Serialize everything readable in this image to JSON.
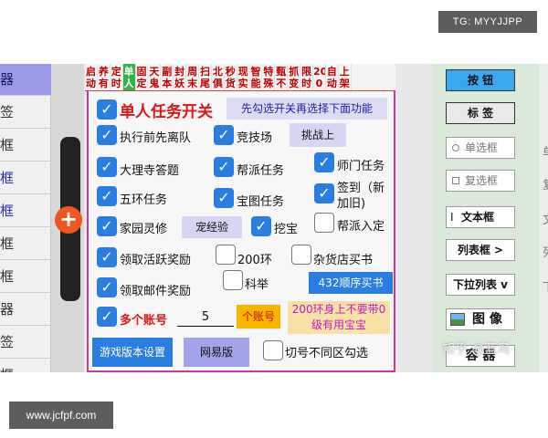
{
  "watermark_top": "TG: MYYJJPP",
  "watermark_bottom": "www.jcfpf.com",
  "watermark_zhihu": "知乎 @蓝鸟",
  "left_list": [
    {
      "text": "器",
      "state": "selected"
    },
    {
      "text": "签",
      "state": "normal"
    },
    {
      "text": "框",
      "state": "normal"
    },
    {
      "text": "框",
      "state": "blue"
    },
    {
      "text": "框",
      "state": "blue"
    },
    {
      "text": "框",
      "state": "normal"
    },
    {
      "text": "框",
      "state": "normal"
    },
    {
      "text": "器",
      "state": "normal"
    },
    {
      "text": "签",
      "state": "normal"
    },
    {
      "text": "框",
      "state": "normal"
    }
  ],
  "tabs": [
    {
      "top": "启",
      "bottom": "动"
    },
    {
      "top": "养",
      "bottom": "有"
    },
    {
      "top": "定",
      "bottom": "时"
    },
    {
      "top": "单",
      "bottom": "人",
      "active": true
    },
    {
      "top": "固",
      "bottom": "定"
    },
    {
      "top": "天",
      "bottom": "鬼"
    },
    {
      "top": "副",
      "bottom": "本"
    },
    {
      "top": "封",
      "bottom": "妖"
    },
    {
      "top": "周",
      "bottom": "末"
    },
    {
      "top": "扫",
      "bottom": "尾"
    },
    {
      "top": "北",
      "bottom": "俱"
    },
    {
      "top": "秒",
      "bottom": "货"
    },
    {
      "top": "现",
      "bottom": "实"
    },
    {
      "top": "智",
      "bottom": "能"
    },
    {
      "top": "特",
      "bottom": "殊"
    },
    {
      "top": "甄",
      "bottom": "不"
    },
    {
      "top": "抓",
      "bottom": "变"
    },
    {
      "top": "限",
      "bottom": "时"
    },
    {
      "top": "20",
      "bottom": "0"
    },
    {
      "top": "自",
      "bottom": "动"
    },
    {
      "top": "上",
      "bottom": "架"
    }
  ],
  "main": {
    "title": "单人任务开关",
    "hint_button": "先勾选开关再选择下面功能",
    "quit_team": "执行前先离队",
    "arena": "竞技场",
    "challenge_button": "挑战上",
    "dali_quiz": "大理寺答题",
    "faction_task": "帮派任务",
    "master_task": "师门任务",
    "five_ring": "五环任务",
    "treasure_map": "宝图任务",
    "signin": "签到（新加旧)",
    "home_spirit": "家园灵修",
    "pet_exp_button": "宠经验",
    "dig_treasure": "挖宝",
    "faction_join": "帮派入定",
    "activity_reward": "领取活跃奖励",
    "ring200": "200环",
    "grocery_buy": "杂货店买书",
    "exam": "科举",
    "mail_reward": "领取邮件奖励",
    "buy432_button": "432顺序买书",
    "multi_account": "多个账号",
    "account_count": "5",
    "account_button": "个账号",
    "ring_note_button": "200环身上不要带0级有用宝宝",
    "version_button": "游戏版本设置",
    "netease_button": "网易版",
    "switch_region": "切号不同区勾选"
  },
  "right": {
    "button": "按 钮",
    "label": "标 签",
    "radio": "单选框",
    "checkbox": "复选框",
    "textbox": "文本框",
    "listbox": "列表框 >",
    "dropdown": "下拉列表 v",
    "image": "图 像",
    "container": "容 器"
  },
  "right_edge": [
    "单",
    "复",
    "文",
    "列",
    "下"
  ],
  "colors": {
    "checkbox_on": "#2a7de1",
    "tab_text": "#c00000",
    "tab_active": "#2fb34a",
    "title_red": "#e01515",
    "panel_border": "#c43ba8"
  }
}
